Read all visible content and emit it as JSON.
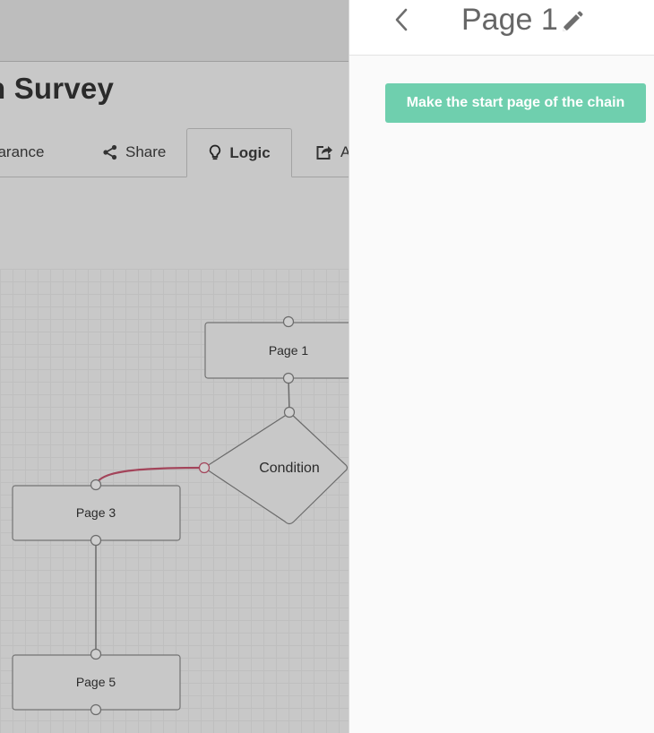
{
  "survey": {
    "title": "n Survey"
  },
  "tabs": [
    {
      "label": "earance",
      "icon": "appearance-icon"
    },
    {
      "label": "Share",
      "icon": "share-icon"
    },
    {
      "label": "Logic",
      "icon": "lightbulb-icon",
      "active": true
    },
    {
      "label": "A",
      "icon": "export-icon"
    }
  ],
  "flow": {
    "nodes": [
      {
        "id": "page1",
        "label": "Page 1",
        "type": "page"
      },
      {
        "id": "condition",
        "label": "Condition",
        "type": "condition"
      },
      {
        "id": "page3",
        "label": "Page 3",
        "type": "page"
      },
      {
        "id": "page5",
        "label": "Page 5",
        "type": "page"
      }
    ],
    "edges": [
      {
        "from": "page1",
        "to": "condition",
        "color": "#6b6b6b"
      },
      {
        "from": "condition",
        "to": "page3",
        "color": "#a3445a"
      },
      {
        "from": "page3",
        "to": "page5",
        "color": "#6b6b6b"
      }
    ]
  },
  "panel": {
    "title": "Page 1",
    "back_icon": "chevron-left-icon",
    "edit_icon": "pencil-icon",
    "start_button_label": "Make the start page of the chain"
  },
  "colors": {
    "accent": "#6fcfae",
    "overlay": "#c8c8c8",
    "highlight_edge": "#a3445a"
  }
}
